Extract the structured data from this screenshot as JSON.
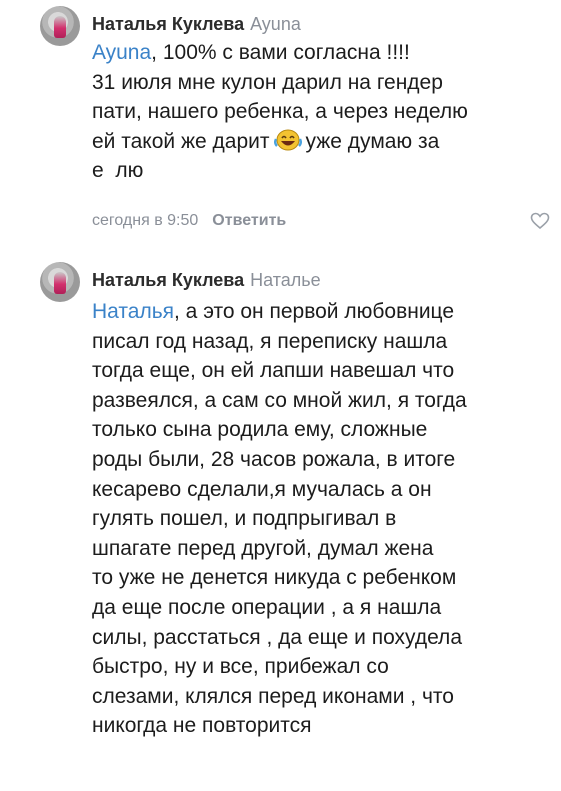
{
  "comments": [
    {
      "author": "Наталья Куклева",
      "reply_to": "Ayuna",
      "mention": "Ayuna",
      "text_line1_rest": ", 100% с вами согласна !!!!",
      "text_line2": "31 июля мне кулон дарил на гендер",
      "text_line3": "пати, нашего ребенка, а через неделю",
      "text_line4_a": "ей такой же дарит",
      "text_line4_b": "уже думаю за",
      "text_line5": "е  лю",
      "emoji": "laughing-tears",
      "time": "сегодня в 9:50",
      "reply_label": "Ответить"
    },
    {
      "author": "Наталья Куклева",
      "reply_to": "Наталье",
      "mention": "Наталья",
      "first_line_rest": ", а это он первой любовнице",
      "lines": [
        "писал год назад, я переписку нашла",
        "тогда еще, он ей лапши навешал что",
        "развеялся, а сам со мной жил, я тогда",
        "только сына родила ему, сложные",
        "роды были, 28 часов рожала, в итоге",
        "кесарево сделали,я мучалась а он",
        "гулять пошел,  и подпрыгивал в",
        "шпагате перед другой, думал жена",
        "то уже не денется никуда с ребенком",
        "да еще после операции , а я нашла",
        "силы, расстаться , да еще и похудела",
        "быстро, ну и все, прибежал со",
        "слезами, клялся перед иконами , что",
        "никогда не повторится"
      ]
    }
  ],
  "colors": {
    "mention": "#3a82c8",
    "meta": "#8a8f98",
    "text": "#1c1c1c"
  }
}
